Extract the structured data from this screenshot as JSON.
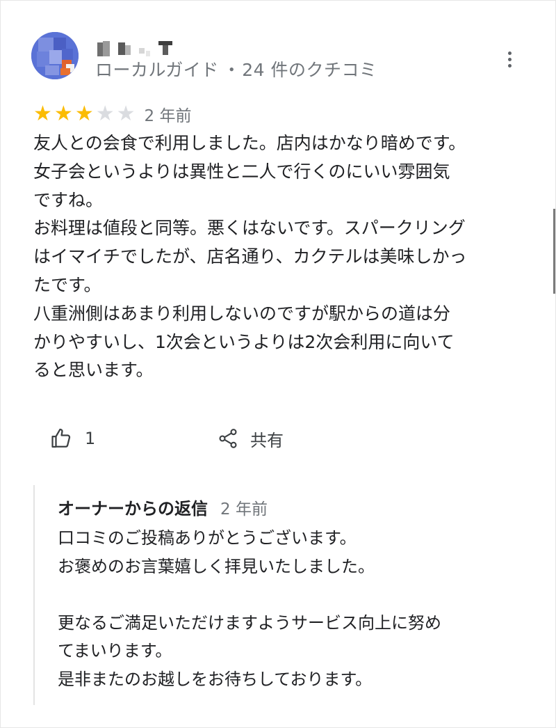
{
  "review": {
    "reviewer": {
      "name": "",
      "badge": "ローカルガイド",
      "review_count": "24 件のクチコミ",
      "meta_separator": "・"
    },
    "rating": {
      "value": 3,
      "max": 5
    },
    "date": "2 年前",
    "text_lines": [
      "友人との会食で利用しました。店内はかなり暗めです。",
      "女子会というよりは異性と二人で行くのにいい雰囲気",
      "ですね。",
      "お料理は値段と同等。悪くはないです。スパークリング",
      "はイマイチでしたが、店名通り、カクテルは美味しかっ",
      "たです。",
      "八重洲側はあまり利用しないのですが駅からの道は分",
      "かりやすいし、1次会というよりは2次会利用に向いて",
      "ると思います。"
    ],
    "likes": "1",
    "share_label": "共有"
  },
  "owner_reply": {
    "title": "オーナーからの返信",
    "date": "2 年前",
    "lines": [
      "口コミのご投稿ありがとうございます。",
      "お褒めのお言葉嬉しく拝見いたしました。",
      "",
      "更なるご満足いただけますようサービス向上に努め",
      "てまいります。",
      "是非またのお越しをお待ちしております。"
    ]
  },
  "icons": {
    "more": "more-vert-icon",
    "like": "thumb-up-icon",
    "share": "share-icon",
    "star": "star-icon"
  },
  "colors": {
    "star_filled": "#fbbc04",
    "star_empty": "#dadce0",
    "secondary_text": "#70757a",
    "reply_border": "#e3e3e3"
  }
}
